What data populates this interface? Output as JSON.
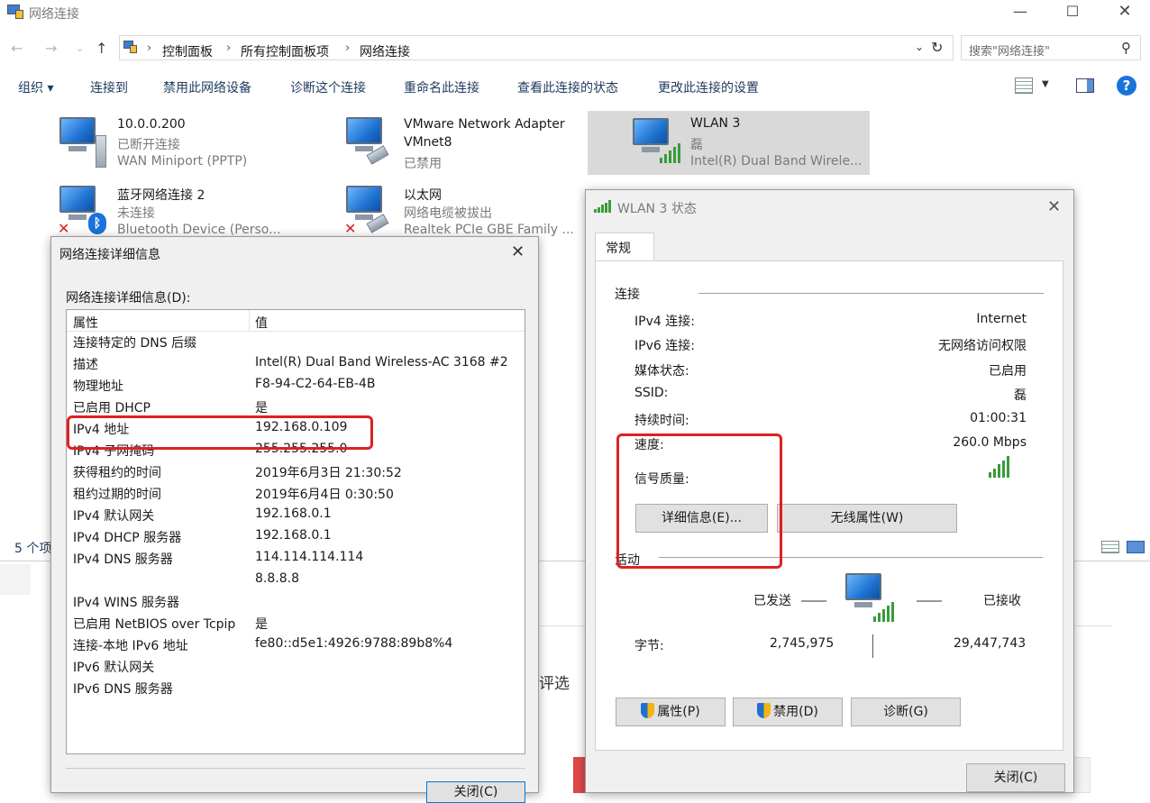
{
  "window": {
    "title": "网络连接"
  },
  "address": {
    "crumbs": [
      "控制面板",
      "所有控制面板项",
      "网络连接"
    ],
    "search_placeholder": "搜索\"网络连接\""
  },
  "toolbar": {
    "items": [
      "组织 ▾",
      "连接到",
      "禁用此网络设备",
      "诊断这个连接",
      "重命名此连接",
      "查看此连接的状态",
      "更改此连接的设置"
    ]
  },
  "connections": [
    {
      "name": "10.0.0.200",
      "status": "已断开连接",
      "device": "WAN Miniport (PPTP)"
    },
    {
      "name": "VMware Network Adapter VMnet8",
      "name_line1": "VMware Network Adapter",
      "name_line2": "VMnet8",
      "status": "已禁用",
      "device": ""
    },
    {
      "name": "WLAN 3",
      "status": "磊",
      "device": "Intel(R) Dual Band Wirele..."
    },
    {
      "name": "蓝牙网络连接 2",
      "status": "未连接",
      "device": "Bluetooth Device (Perso..."
    },
    {
      "name": "以太网",
      "status": "网络电缆被拔出",
      "device": "Realtek PCIe GBE Family ..."
    }
  ],
  "statusbar": {
    "item_count": "5 个项",
    "partial_text": "评选"
  },
  "details_dialog": {
    "title": "网络连接详细信息",
    "list_label": "网络连接详细信息(D):",
    "col_property": "属性",
    "col_value": "值",
    "rows": [
      {
        "prop": "连接特定的 DNS 后缀",
        "val": ""
      },
      {
        "prop": "描述",
        "val": "Intel(R) Dual Band Wireless-AC 3168 #2"
      },
      {
        "prop": "物理地址",
        "val": "F8-94-C2-64-EB-4B"
      },
      {
        "prop": "已启用 DHCP",
        "val": "是"
      },
      {
        "prop": "IPv4 地址",
        "val": "192.168.0.109"
      },
      {
        "prop": "IPv4 子网掩码",
        "val": "255.255.255.0"
      },
      {
        "prop": "获得租约的时间",
        "val": "2019年6月3日 21:30:52"
      },
      {
        "prop": "租约过期的时间",
        "val": "2019年6月4日 0:30:50"
      },
      {
        "prop": "IPv4 默认网关",
        "val": "192.168.0.1"
      },
      {
        "prop": "IPv4 DHCP 服务器",
        "val": "192.168.0.1"
      },
      {
        "prop": "IPv4 DNS 服务器",
        "val": "114.114.114.114"
      },
      {
        "prop": "",
        "val": "8.8.8.8"
      },
      {
        "prop": "IPv4 WINS 服务器",
        "val": ""
      },
      {
        "prop": "已启用 NetBIOS over Tcpip",
        "val": "是"
      },
      {
        "prop": "连接-本地 IPv6 地址",
        "val": "fe80::d5e1:4926:9788:89b8%4"
      },
      {
        "prop": "IPv6 默认网关",
        "val": ""
      },
      {
        "prop": "IPv6 DNS 服务器",
        "val": ""
      }
    ],
    "close_label": "关闭(C)"
  },
  "status_dialog": {
    "title": "WLAN 3 状态",
    "tab": "常规",
    "section_connection": "连接",
    "fields": [
      {
        "label": "IPv4 连接:",
        "value": "Internet"
      },
      {
        "label": "IPv6 连接:",
        "value": "无网络访问权限"
      },
      {
        "label": "媒体状态:",
        "value": "已启用"
      },
      {
        "label": "SSID:",
        "value": "磊"
      },
      {
        "label": "持续时间:",
        "value": "01:00:31"
      },
      {
        "label": "速度:",
        "value": "260.0 Mbps"
      }
    ],
    "signal_label": "信号质量:",
    "signal_bars": 5,
    "details_button": "详细信息(E)...",
    "wireless_button": "无线属性(W)",
    "section_activity": "活动",
    "sent_label": "已发送",
    "received_label": "已接收",
    "bytes_label": "字节:",
    "bytes_sent": "2,745,975",
    "bytes_received": "29,447,743",
    "properties_button": "属性(P)",
    "disable_button": "禁用(D)",
    "diagnose_button": "诊断(G)",
    "close_button": "关闭(C)"
  },
  "colors": {
    "highlight_red": "#e02020",
    "selection": "#d9d9d9",
    "signal_green": "#3a9b3a",
    "link_blue": "#1e3a5c"
  }
}
